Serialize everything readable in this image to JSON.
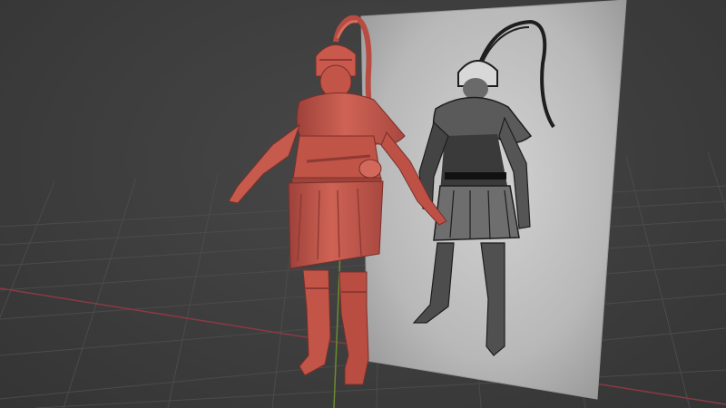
{
  "app": {
    "type": "3d-viewport",
    "view": "perspective"
  },
  "scene": {
    "objects": [
      {
        "name": "sculpted-knight-model",
        "material": "clay"
      },
      {
        "name": "reference-image-plane",
        "content": "knight-sketch"
      }
    ],
    "grid": "on",
    "axes": [
      "x",
      "y"
    ]
  },
  "colors": {
    "background": "#3d3d3d",
    "grid_line": "#4a4a4a",
    "x_axis": "#8a3a44",
    "y_axis": "#6c8a2e",
    "clay": "#c4574c",
    "clay_dark": "#8e3a33",
    "clay_light": "#dc7a6a",
    "reference_bg": "#bcbcbc",
    "sketch_ink": "#1e1e1e"
  }
}
